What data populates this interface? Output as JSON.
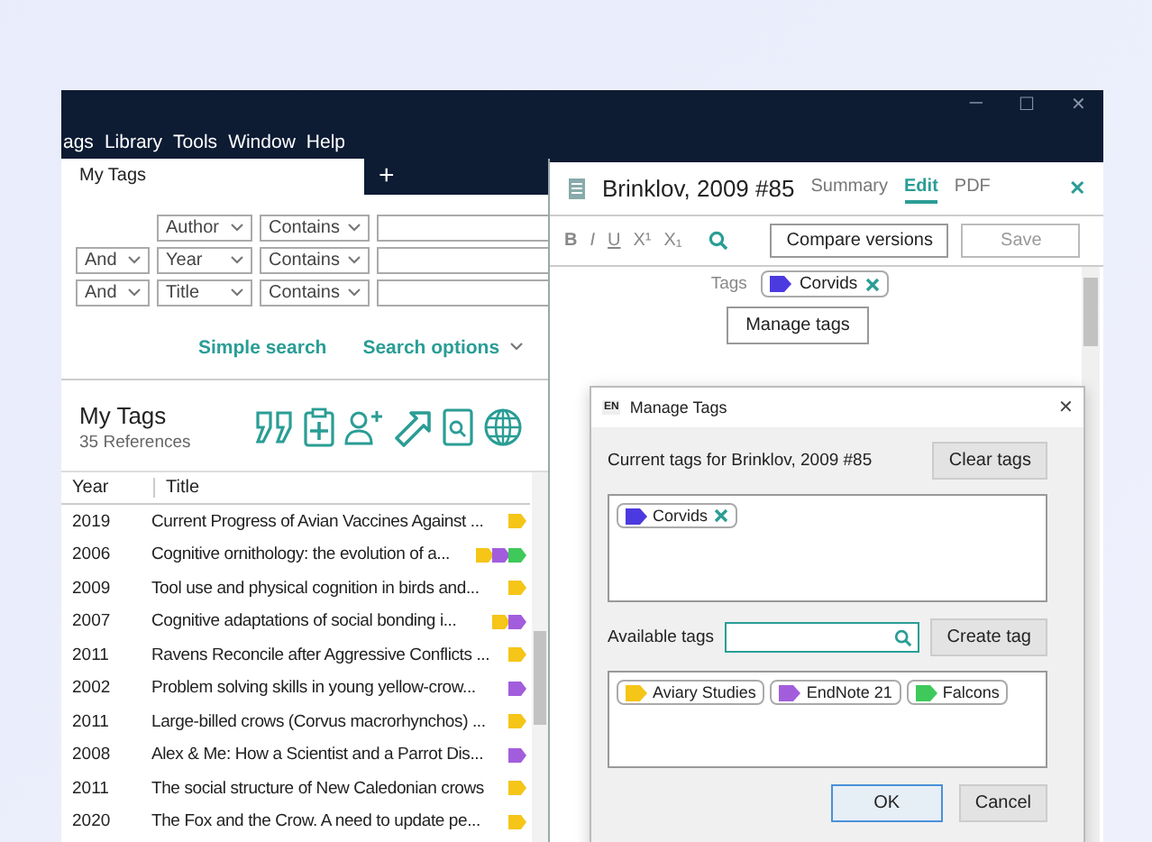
{
  "window": {
    "controls": [
      "─",
      "☐",
      "✕"
    ]
  },
  "menu": [
    "ags",
    "Library",
    "Tools",
    "Window",
    "Help"
  ],
  "tabs": [
    {
      "label": "My Tags",
      "selected": true
    }
  ],
  "new_tab": "+",
  "search": {
    "rows": [
      {
        "connector": null,
        "field": "Author",
        "operator": "Contains",
        "value": ""
      },
      {
        "connector": "And",
        "field": "Year",
        "operator": "Contains",
        "value": ""
      },
      {
        "connector": "And",
        "field": "Title",
        "operator": "Contains",
        "value": ""
      }
    ],
    "simple_search": "Simple search",
    "search_options": "Search options"
  },
  "group": {
    "title": "My Tags",
    "count": "35 References"
  },
  "table": {
    "columns": [
      "Year",
      "Title"
    ],
    "rows": [
      {
        "year": "2019",
        "title": "Current Progress of Avian Vaccines Against ...",
        "tags": [
          {
            "color": "#f5c518"
          }
        ]
      },
      {
        "year": "2006",
        "title": "Cognitive ornithology: the evolution of a...",
        "tags": [
          {
            "color": "#f5c518"
          },
          {
            "color": "#a25ddc"
          },
          {
            "color": "#3ec95a"
          }
        ]
      },
      {
        "year": "2009",
        "title": "Tool use and physical cognition in birds and...",
        "tags": [
          {
            "color": "#f5c518"
          }
        ]
      },
      {
        "year": "2007",
        "title": "Cognitive adaptations of social bonding i...",
        "tags": [
          {
            "color": "#f5c518"
          },
          {
            "color": "#a25ddc"
          }
        ]
      },
      {
        "year": "2011",
        "title": "Ravens Reconcile after Aggressive Conflicts ...",
        "tags": [
          {
            "color": "#f5c518"
          }
        ]
      },
      {
        "year": "2002",
        "title": "Problem solving skills in young yellow-crow...",
        "tags": [
          {
            "color": "#a25ddc"
          }
        ]
      },
      {
        "year": "2011",
        "title": "Large-billed crows (Corvus macrorhynchos) ...",
        "tags": [
          {
            "color": "#f5c518"
          }
        ]
      },
      {
        "year": "2008",
        "title": "Alex & Me: How a Scientist and a Parrot Dis...",
        "tags": [
          {
            "color": "#a25ddc"
          }
        ]
      },
      {
        "year": "2011",
        "title": "The social structure of New Caledonian crows",
        "tags": [
          {
            "color": "#f5c518"
          }
        ]
      },
      {
        "year": "2020",
        "title": "The Fox and the Crow. A need to update pe...",
        "tags": [
          {
            "color": "#f5c518"
          }
        ]
      }
    ]
  },
  "reference": {
    "title": "Brinklov, 2009 #85",
    "tabs": [
      {
        "label": "Summary",
        "selected": false
      },
      {
        "label": "Edit",
        "selected": true
      },
      {
        "label": "PDF",
        "selected": false
      }
    ],
    "close": "✕",
    "format": [
      "B",
      "I",
      "U",
      "X¹",
      "X₁"
    ],
    "compare": "Compare versions",
    "save": "Save",
    "tags_label": "Tags",
    "tags": [
      {
        "name": "Corvids",
        "color": "#4b3adf"
      }
    ],
    "manage": "Manage tags"
  },
  "dialog": {
    "badge": "EN",
    "title": "Manage Tags",
    "close": "✕",
    "current_label": "Current tags for Brinklov, 2009 #85",
    "clear": "Clear tags",
    "current": [
      {
        "name": "Corvids",
        "color": "#4b3adf"
      }
    ],
    "available_label": "Available tags",
    "create": "Create tag",
    "available": [
      {
        "name": "Aviary Studies",
        "color": "#f5c518"
      },
      {
        "name": "EndNote 21",
        "color": "#a25ddc"
      },
      {
        "name": "Falcons",
        "color": "#3ec95a"
      }
    ],
    "ok": "OK",
    "cancel": "Cancel"
  }
}
